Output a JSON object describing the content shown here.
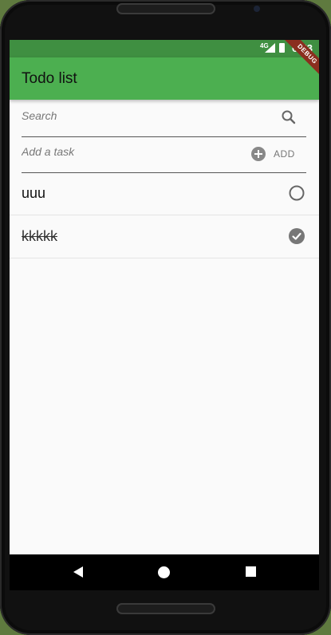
{
  "status_bar": {
    "network": "4G",
    "time": "6:53",
    "debug_banner": "DEBUG"
  },
  "app_bar": {
    "title": "Todo list"
  },
  "search": {
    "placeholder": "Search",
    "value": "",
    "icon": "search-icon"
  },
  "add_task": {
    "placeholder": "Add a task",
    "value": "",
    "button_label": "ADD",
    "icon": "add-circle-icon"
  },
  "tasks": [
    {
      "text": "uuu",
      "done": false
    },
    {
      "text": "kkkkk",
      "done": true
    }
  ],
  "colors": {
    "app_bar": "#4caf50",
    "status_bar": "#3f8f41",
    "background": "#fafafa"
  }
}
